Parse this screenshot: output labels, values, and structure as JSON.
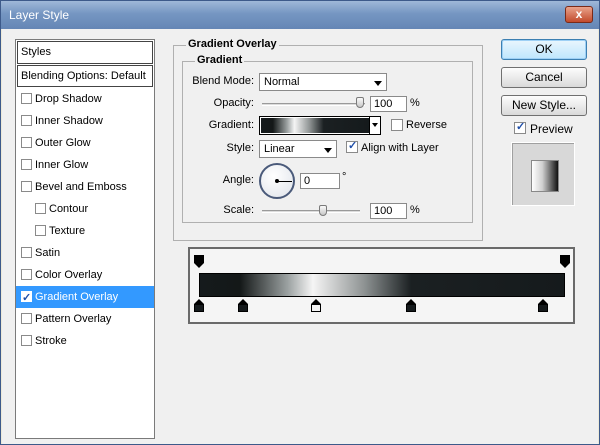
{
  "window": {
    "title": "Layer Style",
    "close_glyph": "x"
  },
  "styles_panel": {
    "header": "Styles",
    "blending_options": "Blending Options: Default",
    "items": [
      {
        "label": "Drop Shadow",
        "checked": false
      },
      {
        "label": "Inner Shadow",
        "checked": false
      },
      {
        "label": "Outer Glow",
        "checked": false
      },
      {
        "label": "Inner Glow",
        "checked": false
      },
      {
        "label": "Bevel and Emboss",
        "checked": false
      },
      {
        "label": "Contour",
        "checked": false,
        "sub": true
      },
      {
        "label": "Texture",
        "checked": false,
        "sub": true
      },
      {
        "label": "Satin",
        "checked": false
      },
      {
        "label": "Color Overlay",
        "checked": false
      },
      {
        "label": "Gradient Overlay",
        "checked": true,
        "selected": true
      },
      {
        "label": "Pattern Overlay",
        "checked": false
      },
      {
        "label": "Stroke",
        "checked": false
      }
    ]
  },
  "gradient_overlay": {
    "title": "Gradient Overlay",
    "section": "Gradient",
    "blend_mode_label": "Blend Mode:",
    "blend_mode": "Normal",
    "opacity_label": "Opacity:",
    "opacity": "100",
    "percent": "%",
    "gradient_label": "Gradient:",
    "reverse_label": "Reverse",
    "reverse_checked": false,
    "style_label": "Style:",
    "style": "Linear",
    "align_label": "Align with Layer",
    "align_checked": true,
    "angle_label": "Angle:",
    "angle": "0",
    "degree": "°",
    "scale_label": "Scale:",
    "scale": "100"
  },
  "buttons": {
    "ok": "OK",
    "cancel": "Cancel",
    "new_style": "New Style...",
    "preview_label": "Preview",
    "preview_checked": true
  },
  "gradient_editor": {
    "opacity_stops": [
      0,
      100
    ],
    "color_stops": [
      {
        "location": 0,
        "color": "#151a1c"
      },
      {
        "location": 12,
        "color": "#151a1c"
      },
      {
        "location": 32,
        "color": "#f5f5f5"
      },
      {
        "location": 58,
        "color": "#151a1c"
      },
      {
        "location": 94,
        "color": "#151a1c"
      }
    ]
  },
  "colors": {
    "selection": "#3399ff",
    "title_bar": "#7596c2"
  }
}
